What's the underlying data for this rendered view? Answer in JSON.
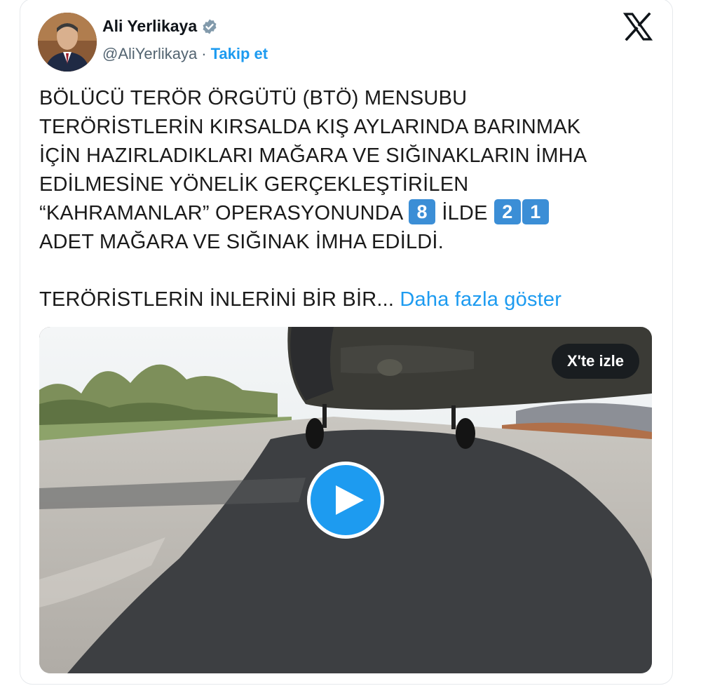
{
  "author": {
    "name": "Ali Yerlikaya",
    "handle": "@AliYerlikaya",
    "separator": "·",
    "follow_label": "Takip et",
    "verified": true
  },
  "logo": "x-logo-icon",
  "tweet": {
    "lines": [
      "BÖLÜCÜ TERÖR ÖRGÜTÜ (BTÖ) MENSUBU",
      "TERÖRİSTLERİN KIRSALDA KIŞ AYLARINDA BARINMAK",
      "İÇİN HAZIRLADIKLARI MAĞARA VE SIĞINAKLARIN İMHA",
      "EDİLMESİNE YÖNELİK GERÇEKLEŞTİRİLEN"
    ],
    "line5_prefix": "“KAHRAMANLAR” OPERASYONUNDA ",
    "line5_keycap1": "8",
    "line5_middle": " İLDE ",
    "line5_keycap2": "2",
    "line5_keycap3": "1",
    "line6": "ADET MAĞARA VE SIĞINAK İMHA EDİLDİ.",
    "truncated": "TERÖRİSTLERİN İNLERİNİ BİR BİR...",
    "show_more_label": "Daha fazla göster"
  },
  "media": {
    "watch_label": "X'te izle",
    "play_icon": "play-icon"
  },
  "colors": {
    "accent": "#1d9bf0",
    "keycap": "#3b8ed6",
    "text": "#0f1419",
    "secondary": "#536471"
  }
}
